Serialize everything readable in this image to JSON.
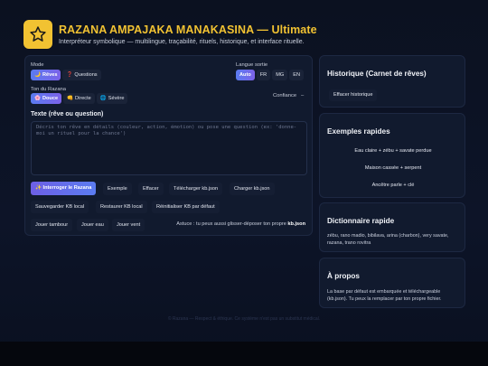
{
  "header": {
    "title": "RAZANA AMPAJAKA MANAKASINA — Ultimate",
    "subtitle": "Interpréteur symbolique — multilingue, traçabilité, rituels, historique, et interface rituelle.",
    "logo_icon": "star-icon",
    "accent_color": "#f1c232"
  },
  "main": {
    "mode_label": "Mode",
    "mode_options": [
      {
        "label": "Rêves",
        "icon": "moon-icon",
        "selected": true
      },
      {
        "label": "Questions",
        "icon": "question-icon",
        "selected": false
      }
    ],
    "language_label": "Langue sortie",
    "language_options": [
      {
        "label": "Auto",
        "selected": true
      },
      {
        "label": "FR",
        "selected": false
      },
      {
        "label": "MG",
        "selected": false
      },
      {
        "label": "EN",
        "selected": false
      }
    ],
    "tone_label": "Ton du Razana",
    "tone_options": [
      {
        "label": "Douce",
        "icon": "flower-icon",
        "selected": true
      },
      {
        "label": "Directe",
        "icon": "hand-icon",
        "selected": false
      },
      {
        "label": "Sévère",
        "icon": "globe-icon",
        "selected": false
      }
    ],
    "confidence_label": "Confiance",
    "confidence_value": "–",
    "text_title": "Texte (rêve ou question)",
    "text_placeholder": "Décris ton rêve en détails (couleur, action, émotion) ou pose une question (ex: 'donne-moi un rituel pour la chance')",
    "text_value": "",
    "buttons": {
      "interroger": "✨ Interroger le Razana",
      "exemple": "Exemple",
      "effacer": "Effacer",
      "telecharger": "Télécharger kb.json",
      "charger": "Charger kb.json",
      "sauvegarder": "Sauvegarder KB local",
      "restaurer": "Restaurer KB local",
      "reinitialiser": "Réinitialiser KB par défaut",
      "jouer_tambour": "Jouer tambour",
      "jouer_eau": "Jouer eau",
      "jouer_vent": "Jouer vent"
    },
    "hint_text": "Astuce : tu peux aussi glisser-déposer ton propre",
    "hint_bold": "kb.json"
  },
  "sidebar": {
    "history": {
      "title": "Historique (Carnet de rêves)",
      "button": "Effacer historique"
    },
    "examples": {
      "title": "Exemples rapides",
      "items": [
        "Eau claire + zébu + savate perdue",
        "Maison cassée + serpent",
        "Ancêtre parle + clé"
      ]
    },
    "dictionary": {
      "title": "Dictionnaire rapide",
      "text": "zébu, rano madio, bibilava, arina (charbon), very savate, razana, trano rovitra"
    },
    "about": {
      "title": "À propos",
      "text": "La base par défaut est embarquée et téléchargeable (kb.json). Tu peux la remplacer par ton propre fichier."
    }
  },
  "footer": {
    "text": "© Razana — Respect & éthique. Ce système n'est pas un substitut médical."
  }
}
